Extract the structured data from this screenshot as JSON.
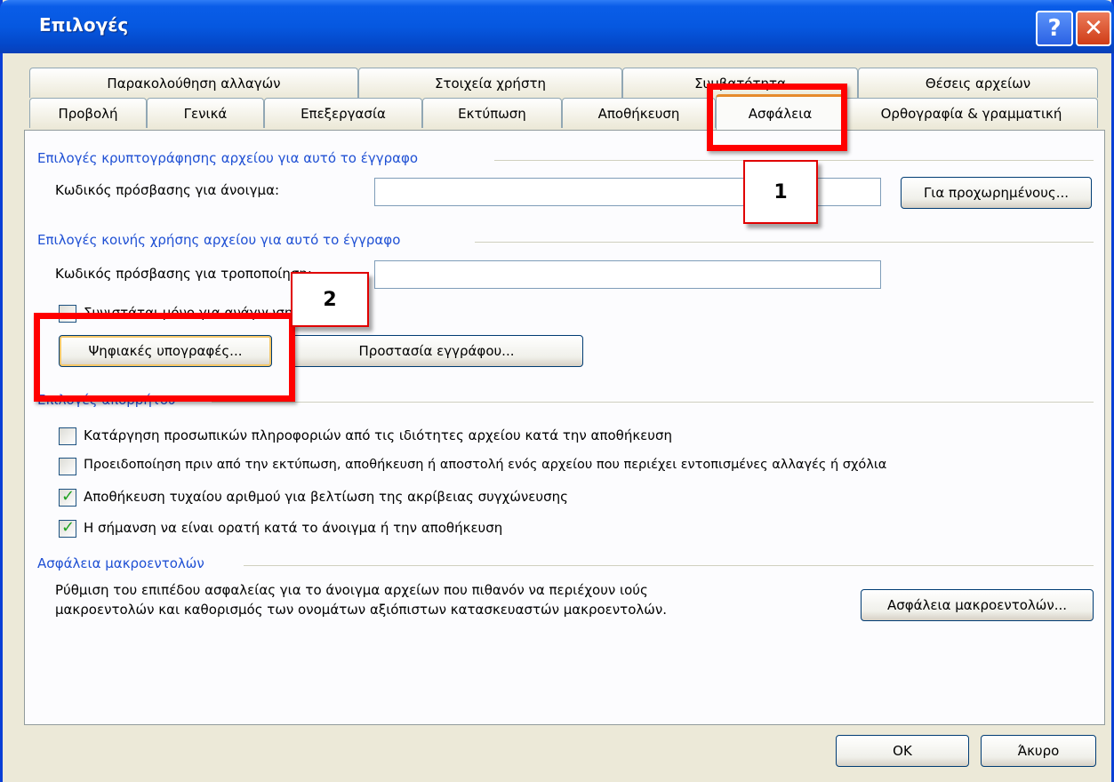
{
  "window": {
    "title": "Επιλογές",
    "help_glyph": "?",
    "close_glyph": "✕"
  },
  "tabs_top": [
    "Παρακολούθηση αλλαγών",
    "Στοιχεία χρήστη",
    "Συμβατότητα",
    "Θέσεις αρχείων"
  ],
  "tabs_bottom": [
    "Προβολή",
    "Γενικά",
    "Επεξεργασία",
    "Εκτύπωση",
    "Αποθήκευση",
    "Ασφάλεια",
    "Ορθογραφία & γραμματική"
  ],
  "encryption": {
    "title": "Επιλογές κρυπτογράφησης αρχείου για αυτό το έγγραφο",
    "open_password_label": "Κωδικός πρόσβασης για άνοιγμα:",
    "open_password_value": "",
    "advanced_button": "Για προχωρημένους..."
  },
  "sharing": {
    "title": "Επιλογές κοινής χρήσης αρχείου για αυτό το έγγραφο",
    "modify_password_label": "Κωδικός πρόσβασης για τροποποίηση:",
    "modify_password_value": "",
    "readonly_label": "Συνιστάται μόνο για ανάγνωση",
    "digital_signatures_button": "Ψηφιακές υπογραφές...",
    "protect_document_button": "Προστασία εγγράφου..."
  },
  "privacy": {
    "title": "Επιλογές απορρήτου",
    "options": [
      {
        "label": "Κατάργηση προσωπικών πληροφοριών από τις ιδιότητες αρχείου κατά την αποθήκευση",
        "checked": false
      },
      {
        "label": "Προειδοποίηση πριν από την εκτύπωση, αποθήκευση ή αποστολή ενός αρχείου που περιέχει εντοπισμένες αλλαγές ή σχόλια",
        "checked": false
      },
      {
        "label": "Αποθήκευση τυχαίου αριθμού για βελτίωση της ακρίβειας συγχώνευσης",
        "checked": true
      },
      {
        "label": "Η σήμανση να είναι ορατή κατά το άνοιγμα ή την αποθήκευση",
        "checked": true
      }
    ]
  },
  "macro": {
    "title": "Ασφάλεια μακροεντολών",
    "description_line1": "Ρύθμιση του επιπέδου ασφαλείας για το άνοιγμα αρχείων που πιθανόν να περιέχουν ιούς",
    "description_line2": "μακροεντολών και καθορισμός των ονομάτων αξιόπιστων κατασκευαστών μακροεντολών.",
    "button": "Ασφάλεια μακροεντολών..."
  },
  "footer": {
    "ok": "OK",
    "cancel": "Άκυρο"
  },
  "callouts": [
    "1",
    "2"
  ]
}
